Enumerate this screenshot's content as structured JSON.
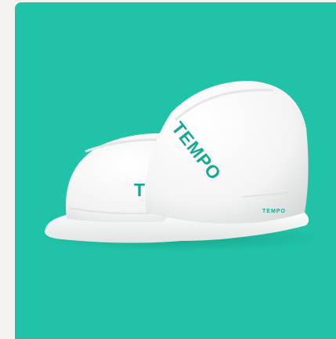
{
  "image": {
    "subject": "hard-hat-pair",
    "background_color": "#21c3a8",
    "page_color": "#f4f3f1",
    "helmet_color": "#f7f7f7"
  },
  "helmet_back": {
    "brand_text": "TE",
    "brand_color": "#17a98f"
  },
  "helmet_front": {
    "brand_text": "TEMPO",
    "brand_color": "#17a98f",
    "side_label": "TEMPO"
  }
}
